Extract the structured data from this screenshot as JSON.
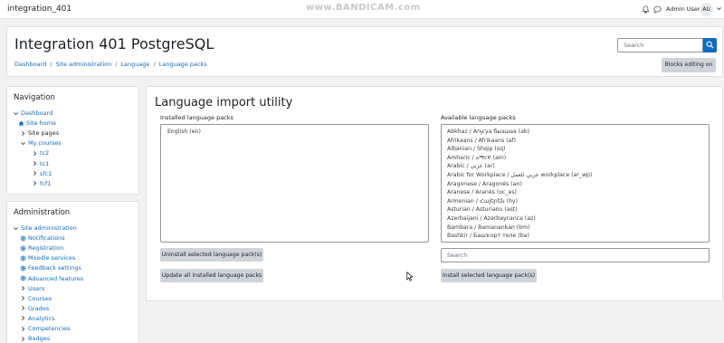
{
  "topbar": {
    "site_short_name": "integration_401",
    "watermark": "www.BANDICAM.com",
    "user_name": "Admin User",
    "user_initials": "AU"
  },
  "header": {
    "title": "Integration 401 PostgreSQL",
    "breadcrumbs": [
      "Dashboard",
      "Site administration",
      "Language",
      "Language packs"
    ],
    "search_placeholder": "Search",
    "blocks_editing_label": "Blocks editing on"
  },
  "navigation": {
    "title": "Navigation",
    "items": [
      {
        "label": "Dashboard",
        "icon": "chevron-down-icon",
        "link": true
      },
      {
        "label": "Site home",
        "icon": "home-icon",
        "link": true
      },
      {
        "label": "Site pages",
        "icon": "chevron-right-icon",
        "link": false
      },
      {
        "label": "My courses",
        "icon": "chevron-down-icon",
        "link": true
      },
      {
        "label": "tc2",
        "icon": "chevron-right-icon",
        "link": true
      },
      {
        "label": "tc1",
        "icon": "chevron-right-icon",
        "link": true
      },
      {
        "label": "sfc1",
        "icon": "chevron-right-icon",
        "link": true
      },
      {
        "label": "fcf1",
        "icon": "chevron-right-icon",
        "link": true
      }
    ]
  },
  "administration": {
    "title": "Administration",
    "items": [
      {
        "label": "Site administration",
        "icon": "chevron-down-icon"
      },
      {
        "label": "Notifications",
        "icon": "gear-icon"
      },
      {
        "label": "Registration",
        "icon": "gear-icon"
      },
      {
        "label": "Moodle services",
        "icon": "gear-icon"
      },
      {
        "label": "Feedback settings",
        "icon": "gear-icon"
      },
      {
        "label": "Advanced features",
        "icon": "gear-icon"
      },
      {
        "label": "Users",
        "icon": "chevron-right-icon"
      },
      {
        "label": "Courses",
        "icon": "chevron-right-icon"
      },
      {
        "label": "Grades",
        "icon": "chevron-right-icon"
      },
      {
        "label": "Analytics",
        "icon": "chevron-right-icon"
      },
      {
        "label": "Competencies",
        "icon": "chevron-right-icon"
      },
      {
        "label": "Badges",
        "icon": "chevron-right-icon"
      }
    ]
  },
  "main": {
    "title": "Language import utility",
    "installed_label": "Installed language packs",
    "installed": [
      "English (en)"
    ],
    "available_label": "Available language packs",
    "available": [
      "Abkhaz / Аҧсуа бызшәа (ab)",
      "Afrikaans / Afrikaans (af)",
      "Albanian / Shqip (sq)",
      "Amharic / አማርኛ (am)",
      "Arabic / عربي (ar)",
      "Arabic for Workplace / عربي للعمل workplace (ar_wp)",
      "Aragonese / Aragonés (an)",
      "Aranese / Aranés (oc_es)",
      "Armenian / Հայերեն (hy)",
      "Asturian / Asturianu (ast)",
      "Azerbaijani / Azərbaycanca (az)",
      "Bambara / Bamanankan (bm)",
      "Bashkir / Башҡорт теле (ba)"
    ],
    "uninstall_label": "Uninstall selected language pack(s)",
    "update_label": "Update all installed language packs",
    "filter_placeholder": "Search",
    "install_label": "Install selected language pack(s)"
  },
  "colors": {
    "link": "#0f6cbf",
    "primary": "#0f6cbf",
    "button_secondary": "#ced4da",
    "page_bg": "#f2f2f2"
  }
}
